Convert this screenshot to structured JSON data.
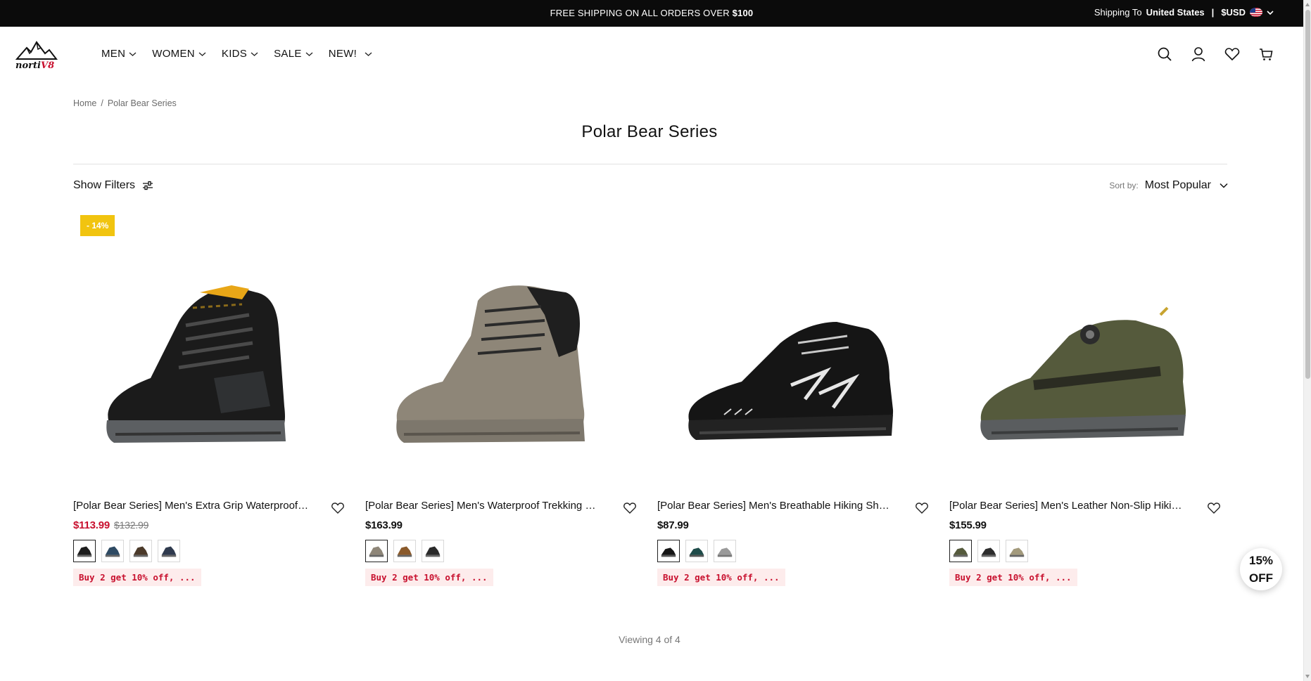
{
  "announcement": {
    "text": "FREE SHIPPING ON ALL ORDERS OVER ",
    "amount": "$100",
    "shipping_to_label": "Shipping To",
    "country": "United States",
    "separator": "|",
    "currency": "$USD"
  },
  "brand": {
    "logo_text": "nortiV8"
  },
  "nav": {
    "items": [
      {
        "label": "MEN"
      },
      {
        "label": "WOMEN"
      },
      {
        "label": "KIDS"
      },
      {
        "label": "SALE"
      },
      {
        "label": "NEW!"
      }
    ]
  },
  "header_icons": [
    "search-icon",
    "account-icon",
    "wishlist-icon",
    "cart-icon"
  ],
  "breadcrumb": {
    "home": "Home",
    "separator": "/",
    "current": "Polar Bear Series"
  },
  "page": {
    "title": "Polar Bear Series"
  },
  "toolbar": {
    "filters_label": "Show Filters",
    "sort_label": "Sort by:",
    "sort_value": "Most Popular"
  },
  "products": [
    {
      "name": "[Polar Bear Series] Men's Extra Grip Waterproof Mid Hiking Boots",
      "price": "$113.99",
      "original_price": "$132.99",
      "badge": "- 14%",
      "promo": "Buy 2 get 10% off, ...",
      "swatches": [
        "#1d1d1d",
        "#2e4a63",
        "#4b3a2a",
        "#2f3a4e"
      ]
    },
    {
      "name": "[Polar Bear Series] Men's Waterproof Trekking Boots",
      "price": "$163.99",
      "original_price": "",
      "badge": "",
      "promo": "Buy 2 get 10% off, ...",
      "swatches": [
        "#8e8678",
        "#8a5a2b",
        "#2a2a2a"
      ]
    },
    {
      "name": "[Polar Bear Series] Men's Breathable Hiking Shoes",
      "price": "$87.99",
      "original_price": "",
      "badge": "",
      "promo": "Buy 2 get 10% off, ...",
      "swatches": [
        "#161616",
        "#1f4c4a",
        "#9a9a9a"
      ]
    },
    {
      "name": "[Polar Bear Series] Men's Leather Non-Slip Hiking Shoes",
      "price": "$155.99",
      "original_price": "",
      "badge": "",
      "promo": "Buy 2 get 10% off, ...",
      "swatches": [
        "#555a3c",
        "#2d2d2d",
        "#a39a7c"
      ]
    }
  ],
  "pagination": {
    "viewing_text": "Viewing 4 of 4"
  },
  "offer_badge": {
    "line1": "15%",
    "line2": "OFF"
  },
  "colors": {
    "sale": "#c8102e",
    "badge": "#f1c40f",
    "promo_bg": "#fdecec",
    "topbar": "#0b0b0b"
  }
}
